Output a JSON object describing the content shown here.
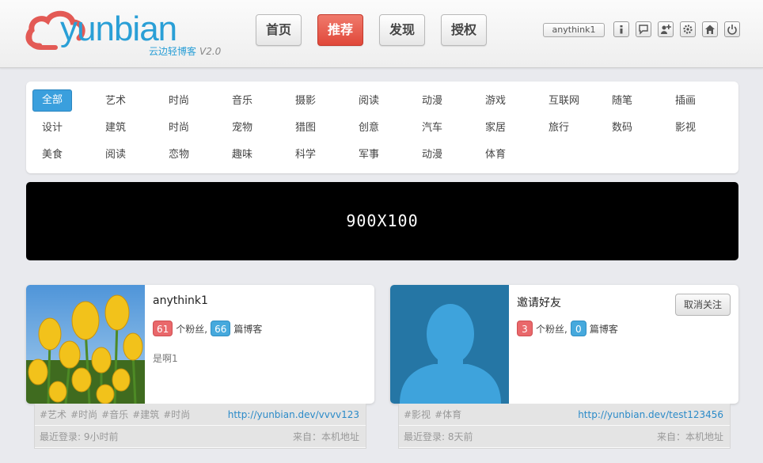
{
  "logo": {
    "wordmark": "yunbian",
    "tagline": "云边轻博客",
    "version": "V2.0"
  },
  "nav": [
    {
      "label": "首页",
      "active": false
    },
    {
      "label": "推荐",
      "active": true
    },
    {
      "label": "发现",
      "active": false
    },
    {
      "label": "授权",
      "active": false
    }
  ],
  "toolbar": {
    "username": "anythink1",
    "icons": [
      "info-icon",
      "message-icon",
      "add-friend-icon",
      "settings-icon",
      "home-icon",
      "power-icon"
    ]
  },
  "categories": {
    "rows": [
      [
        "全部",
        "艺术",
        "时尚",
        "音乐",
        "摄影",
        "阅读",
        "动漫",
        "游戏",
        "互联网",
        "随笔",
        "插画"
      ],
      [
        "设计",
        "建筑",
        "时尚",
        "宠物",
        "猎图",
        "创意",
        "汽车",
        "家居",
        "旅行",
        "数码",
        "影视"
      ],
      [
        "美食",
        "阅读",
        "恋物",
        "趣味",
        "科学",
        "军事",
        "动漫",
        "体育"
      ]
    ],
    "active": "全部"
  },
  "banner": {
    "text": "900X100"
  },
  "cards": [
    {
      "name": "anythink1",
      "fans": "61",
      "fans_label": "个粉丝,",
      "blogs": "66",
      "blogs_label": "篇博客",
      "bio": "是啊1",
      "tags": [
        "#艺术",
        "#时尚",
        "#音乐",
        "#建筑",
        "#时尚"
      ],
      "url": "http://yunbian.dev/vvvv123",
      "last_login": "最近登录: 9小时前",
      "source": "来自：本机地址",
      "photo": "yellow-tulips-photo"
    },
    {
      "name": "邀请好友",
      "fans": "3",
      "fans_label": "个粉丝,",
      "blogs": "0",
      "blogs_label": "篇博客",
      "unfollow_label": "取消关注",
      "tags": [
        "#影视",
        "#体育"
      ],
      "url": "http://yunbian.dev/test123456",
      "last_login": "最近登录: 8天前",
      "source": "来自：本机地址",
      "photo": "default-avatar"
    }
  ],
  "colors": {
    "accent_blue": "#2a9fd6",
    "accent_red": "#e0483a",
    "badge_red": "#e9686b",
    "badge_blue": "#46a9dd"
  }
}
